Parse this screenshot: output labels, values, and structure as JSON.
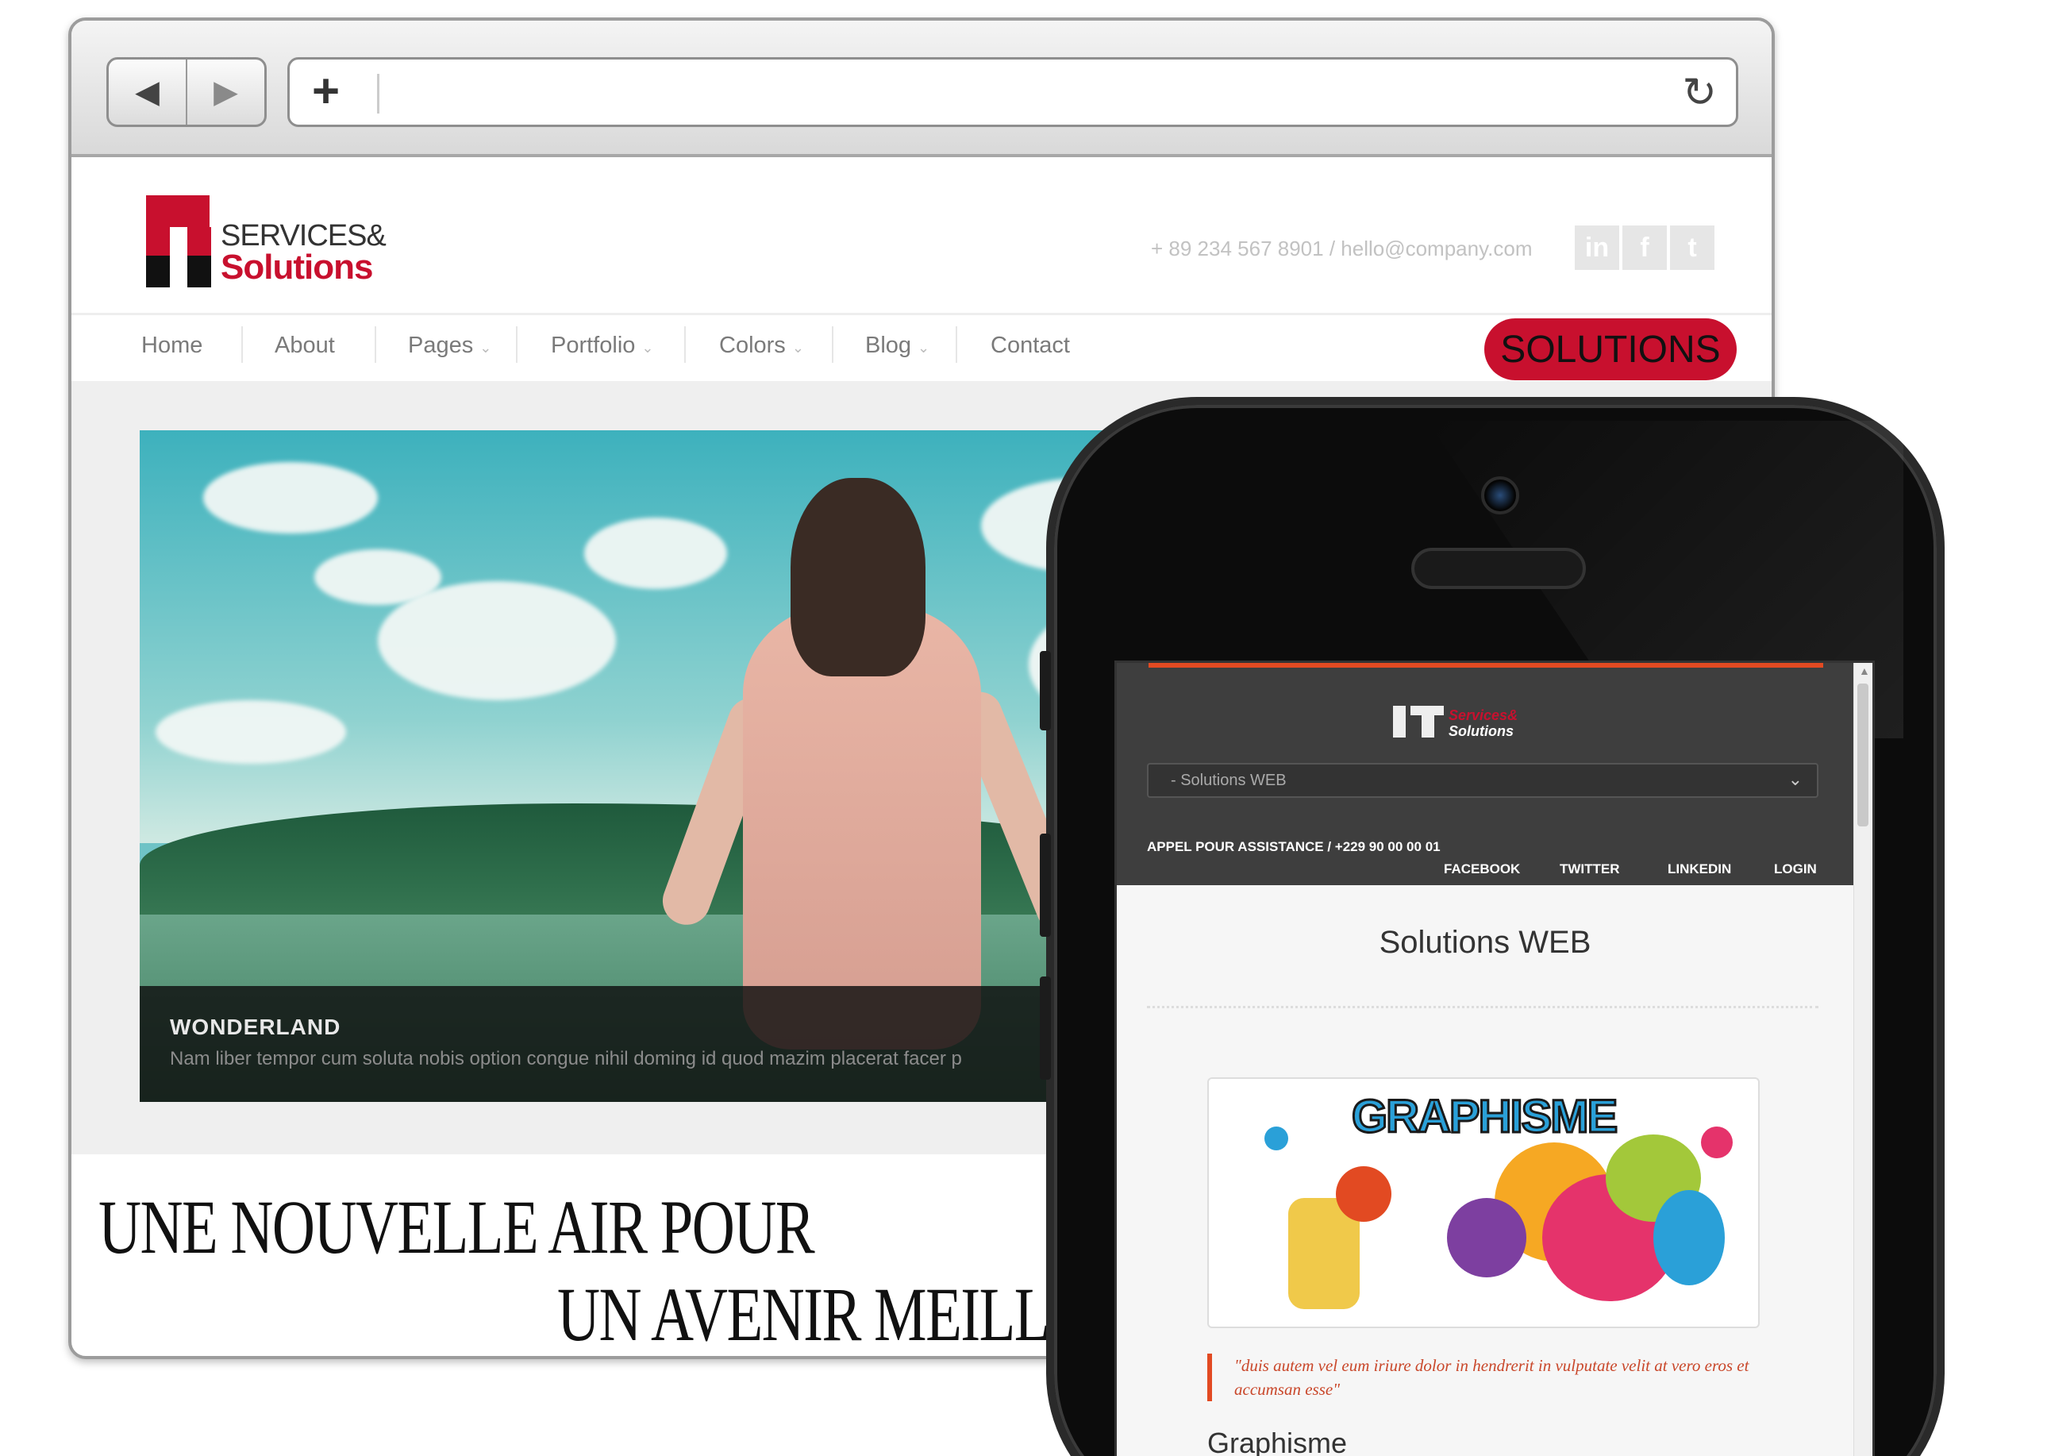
{
  "desktop": {
    "logo": {
      "services": "SERVICES&",
      "solutions": "Solutions"
    },
    "contact": "+ 89 234 567 8901 / hello@company.com",
    "social": [
      {
        "icon": "linkedin-icon",
        "glyph": "in"
      },
      {
        "icon": "facebook-icon",
        "glyph": "f"
      },
      {
        "icon": "twitter-icon",
        "glyph": "t"
      }
    ],
    "menu": [
      {
        "label": "Home",
        "dropdown": false
      },
      {
        "label": "About",
        "dropdown": false
      },
      {
        "label": "Pages",
        "dropdown": true
      },
      {
        "label": "Portfolio",
        "dropdown": true
      },
      {
        "label": "Colors",
        "dropdown": true
      },
      {
        "label": "Blog",
        "dropdown": true
      },
      {
        "label": "Contact",
        "dropdown": false
      }
    ],
    "badge": "SOLUTIONS",
    "slide": {
      "title": "WONDERLAND",
      "text": "Nam liber tempor cum soluta nobis option congue nihil doming id quod mazim placerat facer p"
    },
    "tagline": {
      "line1": "UNE NOUVELLE AIR POUR",
      "line2": "UN AVENIR MEILLEUR"
    }
  },
  "browser_chrome": {
    "back": "◀",
    "forward": "▶",
    "new_tab": "+",
    "reload": "↻"
  },
  "mobile": {
    "logo": {
      "services": "Services&",
      "solutions": "Solutions"
    },
    "select_value": "- Solutions WEB",
    "assist": "APPEL POUR ASSISTANCE / +229 90 00 00 01",
    "links": [
      "FACEBOOK",
      "TWITTER",
      "LINKEDIN",
      "LOGIN"
    ],
    "page_title": "Solutions WEB",
    "image_word": "GRAPHISME",
    "quote": "\"duis autem vel eum iriure dolor in hendrerit in vulputate velit at vero eros et accumsan esse\"",
    "section_title": "Graphisme"
  },
  "colors": {
    "brand_red": "#c8102e",
    "accent_orange": "#e24a22",
    "mobile_header": "#3e3e3e"
  }
}
